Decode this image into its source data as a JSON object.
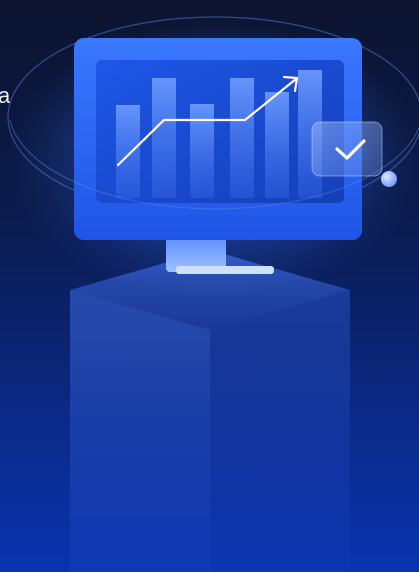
{
  "fragment_text": "a",
  "colors": {
    "background_top": "#0c1430",
    "background_bottom": "#0a34b0",
    "monitor_frame": "#2f6bff",
    "monitor_screen": "#1a4fdc",
    "accent_white": "#ffffff",
    "orb": "#8fb4ff"
  },
  "icons": {
    "monitor": "monitor-icon",
    "trend": "trend-up-arrow-icon",
    "check": "check-badge-icon",
    "orb": "orbit-dot-icon"
  }
}
